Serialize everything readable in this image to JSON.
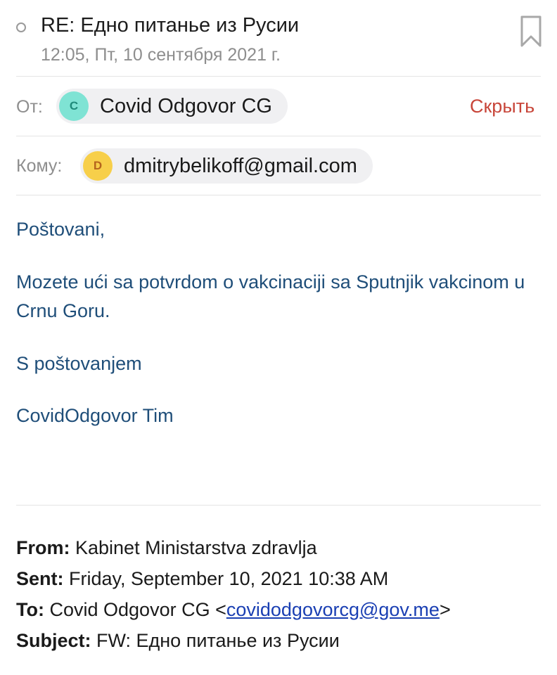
{
  "header": {
    "subject": "RE: Едно питанье из Русии",
    "date": "12:05, Пт, 10 сентября 2021 г.",
    "icons": {
      "read_status": "read-status-circle-icon",
      "bookmark": "bookmark-icon"
    }
  },
  "from_row": {
    "label": "От:",
    "avatar_letter": "C",
    "sender": "Covid Odgovor CG",
    "hide_label": "Скрыть",
    "avatar_bg": "#7fe3d4",
    "avatar_fg": "#1f8a7a"
  },
  "to_row": {
    "label": "Кому:",
    "avatar_letter": "D",
    "recipient": "dmitrybelikoff@gmail.com",
    "avatar_bg": "#f7cf4a",
    "avatar_fg": "#b5651d"
  },
  "message": {
    "greeting": "Poštovani,",
    "paragraph": "Mozete ući sa potvrdom o vakcinaciji sa Sputnjik vakcinom u Crnu Goru.",
    "closing": "S poštovanjem",
    "signature": "CovidOdgovor Tim"
  },
  "forwarded": {
    "from_label": "From:",
    "from_value": " Kabinet Ministarstva zdravlja",
    "sent_label": "Sent:",
    "sent_value": " Friday, September 10, 2021 10:38 AM",
    "to_label": "To:",
    "to_name": " Covid Odgovor CG <",
    "to_email": "covidodgovorcg@gov.me",
    "to_close": ">",
    "subject_label": "Subject:",
    "subject_value": " FW: Едно питанье из Русии"
  },
  "colors": {
    "body_text": "#1f4e79",
    "hide_link": "#c8463a",
    "email_link": "#1a3fb3"
  }
}
